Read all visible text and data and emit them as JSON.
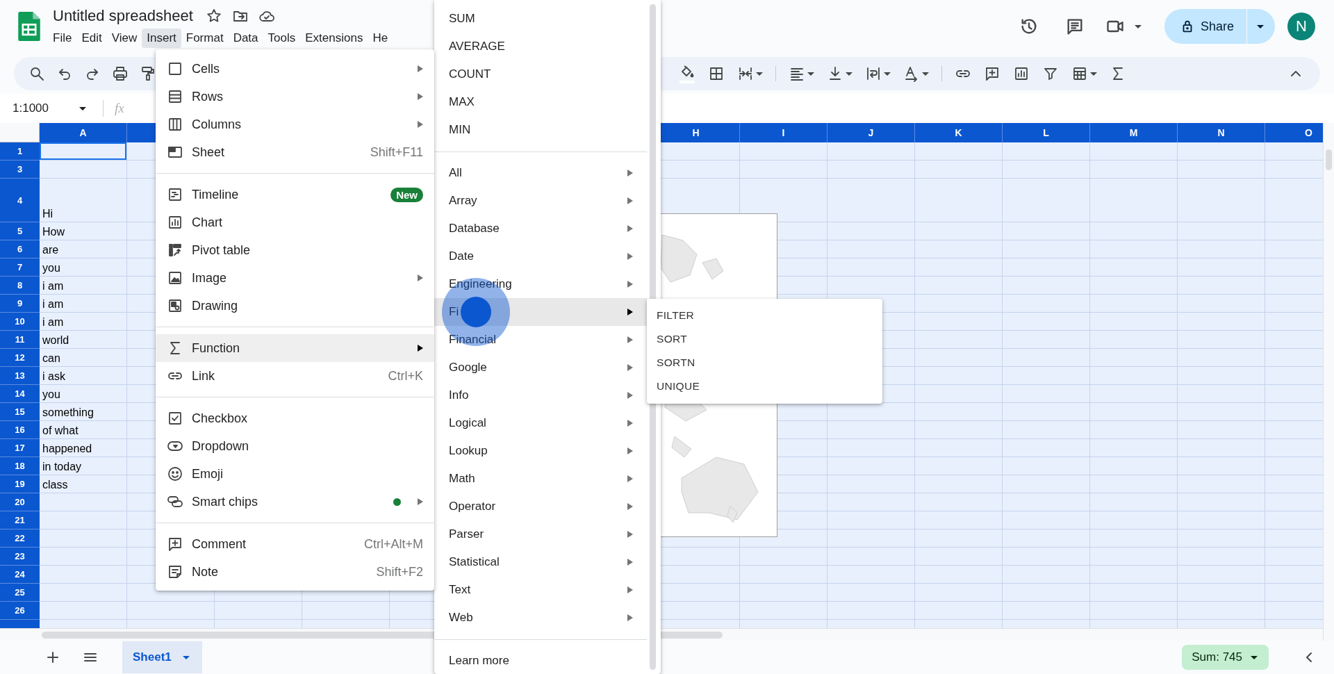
{
  "doc_title": "Untitled spreadsheet",
  "menu_bar": [
    {
      "label": "File",
      "selected": false
    },
    {
      "label": "Edit",
      "selected": false
    },
    {
      "label": "View",
      "selected": false
    },
    {
      "label": "Insert",
      "selected": true
    },
    {
      "label": "Format",
      "selected": false
    },
    {
      "label": "Data",
      "selected": false
    },
    {
      "label": "Tools",
      "selected": false
    },
    {
      "label": "Extensions",
      "selected": false
    },
    {
      "label": "He",
      "selected": false
    }
  ],
  "share": {
    "label": "Share"
  },
  "avatar": {
    "initial": "N"
  },
  "name_box": "1:1000",
  "formula_label": "fx",
  "columns": [
    "A",
    "H",
    "I",
    "J",
    "K",
    "L",
    "M",
    "N",
    "O"
  ],
  "rows": [
    {
      "number": "1",
      "kind": "normal",
      "active": true
    },
    {
      "number": "3",
      "kind": "normal",
      "active": false
    },
    {
      "number": "4",
      "kind": "tall",
      "value": "Hi",
      "active": false
    },
    {
      "number": "5",
      "kind": "normal",
      "value": "How",
      "active": false
    },
    {
      "number": "6",
      "kind": "normal",
      "value": "are",
      "active": false
    },
    {
      "number": "7",
      "kind": "normal",
      "value": "you",
      "active": false
    },
    {
      "number": "8",
      "kind": "normal",
      "value": "i am",
      "active": false
    },
    {
      "number": "9",
      "kind": "normal",
      "value": "i am",
      "active": false
    },
    {
      "number": "10",
      "kind": "normal",
      "value": "i am",
      "active": false
    },
    {
      "number": "11",
      "kind": "normal",
      "value": "world",
      "active": false
    },
    {
      "number": "12",
      "kind": "normal",
      "value": "can",
      "active": false
    },
    {
      "number": "13",
      "kind": "normal",
      "value": "i ask",
      "active": false
    },
    {
      "number": "14",
      "kind": "normal",
      "value": "you",
      "active": false
    },
    {
      "number": "15",
      "kind": "normal",
      "value": "something",
      "active": false
    },
    {
      "number": "16",
      "kind": "normal",
      "value": "of what",
      "active": false
    },
    {
      "number": "17",
      "kind": "normal",
      "value": "happened",
      "active": false
    },
    {
      "number": "18",
      "kind": "normal",
      "value": "in today",
      "active": false
    },
    {
      "number": "19",
      "kind": "normal",
      "value": "class",
      "active": false
    },
    {
      "number": "20",
      "kind": "normal",
      "active": false
    },
    {
      "number": "21",
      "kind": "normal",
      "active": false
    },
    {
      "number": "22",
      "kind": "normal",
      "active": false
    },
    {
      "number": "23",
      "kind": "normal",
      "active": false
    },
    {
      "number": "24",
      "kind": "normal",
      "active": false
    },
    {
      "number": "25",
      "kind": "normal",
      "active": false
    },
    {
      "number": "26",
      "kind": "normal",
      "active": false
    }
  ],
  "insert_menu": {
    "groups": [
      [
        {
          "label": "Cells",
          "selected": false,
          "submenu": true
        },
        {
          "label": "Rows",
          "selected": false,
          "submenu": true
        },
        {
          "label": "Columns",
          "selected": false,
          "submenu": true
        },
        {
          "label": "Sheet",
          "selected": false,
          "submenu": false,
          "shortcut": "Shift+F11"
        }
      ],
      [
        {
          "label": "Timeline",
          "selected": false,
          "submenu": false,
          "badge": "New"
        },
        {
          "label": "Chart",
          "selected": false,
          "submenu": false
        },
        {
          "label": "Pivot table",
          "selected": false,
          "submenu": false
        },
        {
          "label": "Image",
          "selected": false,
          "submenu": true
        },
        {
          "label": "Drawing",
          "selected": false,
          "submenu": false
        }
      ],
      [
        {
          "label": "Function",
          "selected": true,
          "submenu": true
        },
        {
          "label": "Link",
          "selected": false,
          "submenu": false,
          "shortcut": "Ctrl+K"
        }
      ],
      [
        {
          "label": "Checkbox",
          "selected": false,
          "submenu": false
        },
        {
          "label": "Dropdown",
          "selected": false,
          "submenu": false
        },
        {
          "label": "Emoji",
          "selected": false,
          "submenu": false
        },
        {
          "label": "Smart chips",
          "selected": false,
          "submenu": true,
          "dot": true
        }
      ],
      [
        {
          "label": "Comment",
          "selected": false,
          "submenu": false,
          "shortcut": "Ctrl+Alt+M"
        },
        {
          "label": "Note",
          "selected": false,
          "submenu": false,
          "shortcut": "Shift+F2"
        }
      ]
    ]
  },
  "function_menu": {
    "top": [
      "SUM",
      "AVERAGE",
      "COUNT",
      "MAX",
      "MIN"
    ],
    "categories": [
      {
        "label": "All",
        "selected": false
      },
      {
        "label": "Array",
        "selected": false
      },
      {
        "label": "Database",
        "selected": false
      },
      {
        "label": "Date",
        "selected": false
      },
      {
        "label": "Engineering",
        "selected": false
      },
      {
        "label": "Fi",
        "selected": true
      },
      {
        "label": "Financial",
        "selected": false
      },
      {
        "label": "Google",
        "selected": false
      },
      {
        "label": "Info",
        "selected": false
      },
      {
        "label": "Logical",
        "selected": false
      },
      {
        "label": "Lookup",
        "selected": false
      },
      {
        "label": "Math",
        "selected": false
      },
      {
        "label": "Operator",
        "selected": false
      },
      {
        "label": "Parser",
        "selected": false
      },
      {
        "label": "Statistical",
        "selected": false
      },
      {
        "label": "Text",
        "selected": false
      },
      {
        "label": "Web",
        "selected": false
      }
    ],
    "footer": "Learn more"
  },
  "filter_menu": [
    "FILTER",
    "SORT",
    "SORTN",
    "UNIQUE"
  ],
  "sheet_tabs": [
    {
      "label": "Sheet1",
      "selected": true
    }
  ],
  "sum": "Sum: 745"
}
